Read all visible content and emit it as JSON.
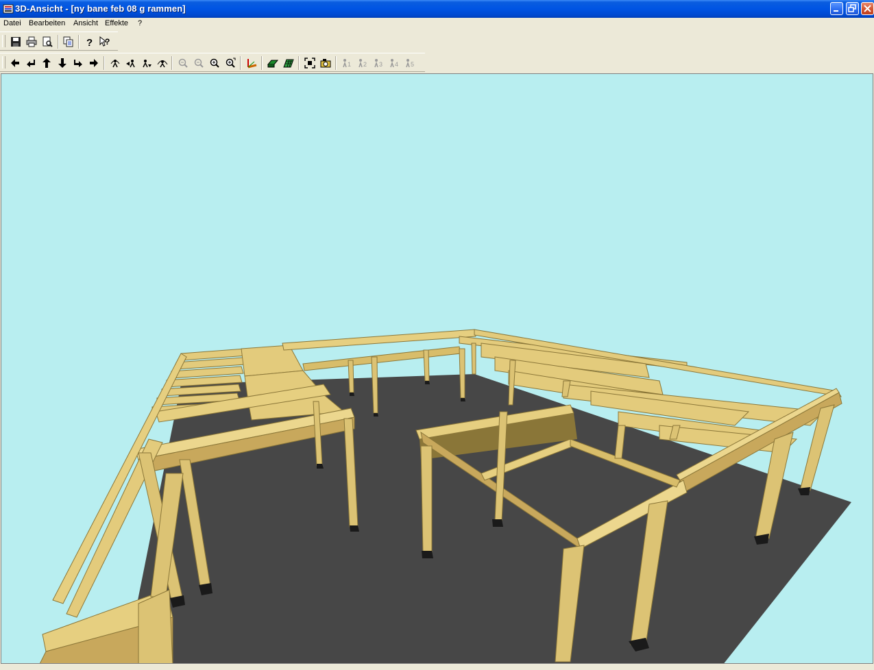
{
  "window": {
    "title": "3D-Ansicht - [ny bane feb 08 g rammen]",
    "controls": [
      "minimize-icon",
      "restore-icon",
      "close-icon"
    ]
  },
  "menu": {
    "items": [
      "Datei",
      "Bearbeiten",
      "Ansicht",
      "Effekte",
      "?"
    ]
  },
  "toolbar1": {
    "buttons": [
      "save-icon",
      "print-icon",
      "print-preview-icon",
      "copy-icon",
      "help-icon",
      "context-help-icon"
    ]
  },
  "toolbar2": {
    "buttons": [
      "arrow-left-icon",
      "turn-left-icon",
      "arrow-up-icon",
      "arrow-down-icon",
      "turn-right-icon",
      "arrow-right-icon",
      "view-rotate-up-icon",
      "view-left-icon",
      "view-down-icon",
      "view-rotate-icon",
      "zoom-out-all-icon",
      "zoom-out-icon",
      "zoom-in-icon",
      "zoom-in-all-icon",
      "axis-icon",
      "surface-icon",
      "grid-icon",
      "fit-view-icon",
      "camera-icon",
      "viewpoint-1-icon",
      "viewpoint-2-icon",
      "viewpoint-3-icon",
      "viewpoint-4-icon",
      "viewpoint-5-icon"
    ],
    "viewpoint_labels": [
      "1",
      "2",
      "3",
      "4",
      "5"
    ]
  },
  "colors": {
    "sky": "#b8eef0",
    "ground": "#474747",
    "timber_top": "#e6cf80",
    "timber_side": "#c8a85c",
    "timber_shadow": "#8a7638",
    "footing": "#1a1a1a"
  }
}
